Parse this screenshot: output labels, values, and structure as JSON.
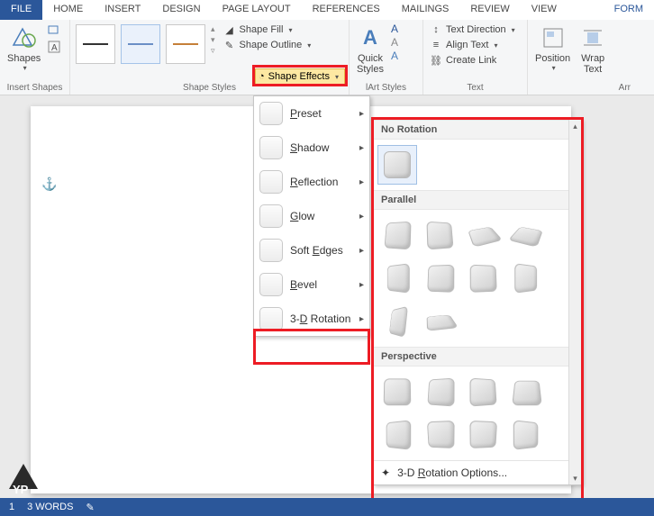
{
  "tabs": {
    "file": "FILE",
    "home": "HOME",
    "insert": "INSERT",
    "design": "DESIGN",
    "pagelayout": "PAGE LAYOUT",
    "references": "REFERENCES",
    "mailings": "MAILINGS",
    "review": "REVIEW",
    "view": "VIEW",
    "format": "FORM"
  },
  "ribbon": {
    "insert_shapes": {
      "shapes": "Shapes",
      "label": "Insert Shapes"
    },
    "shape_styles": {
      "label": "Shape Styles",
      "fill": "Shape Fill",
      "outline": "Shape Outline",
      "effects": "Shape Effects"
    },
    "wordart": {
      "quick": "Quick",
      "styles": "Styles",
      "label": "lArt Styles"
    },
    "text": {
      "direction": "Text Direction",
      "align": "Align Text",
      "link": "Create Link",
      "label": "Text"
    },
    "arrange": {
      "position": "Position",
      "wrap": "Wrap",
      "wrap2": "Text",
      "label": "Arr"
    }
  },
  "effects_menu": {
    "preset_pre": "",
    "preset_u": "P",
    "preset_post": "reset",
    "shadow_pre": "",
    "shadow_u": "S",
    "shadow_post": "hadow",
    "reflection_pre": "",
    "reflection_u": "R",
    "reflection_post": "eflection",
    "glow_pre": "",
    "glow_u": "G",
    "glow_post": "low",
    "soft_pre": "Soft ",
    "soft_u": "E",
    "soft_post": "dges",
    "bevel_pre": "",
    "bevel_u": "B",
    "bevel_post": "evel",
    "rotation_pre": "3-",
    "rotation_u": "D",
    "rotation_post": " Rotation"
  },
  "gallery": {
    "no_rotation": "No Rotation",
    "parallel": "Parallel",
    "perspective": "Perspective",
    "options_pre": "3-D ",
    "options_u": "R",
    "options_post": "otation Options..."
  },
  "status": {
    "page_label": "1",
    "words": "3 WORDS"
  }
}
